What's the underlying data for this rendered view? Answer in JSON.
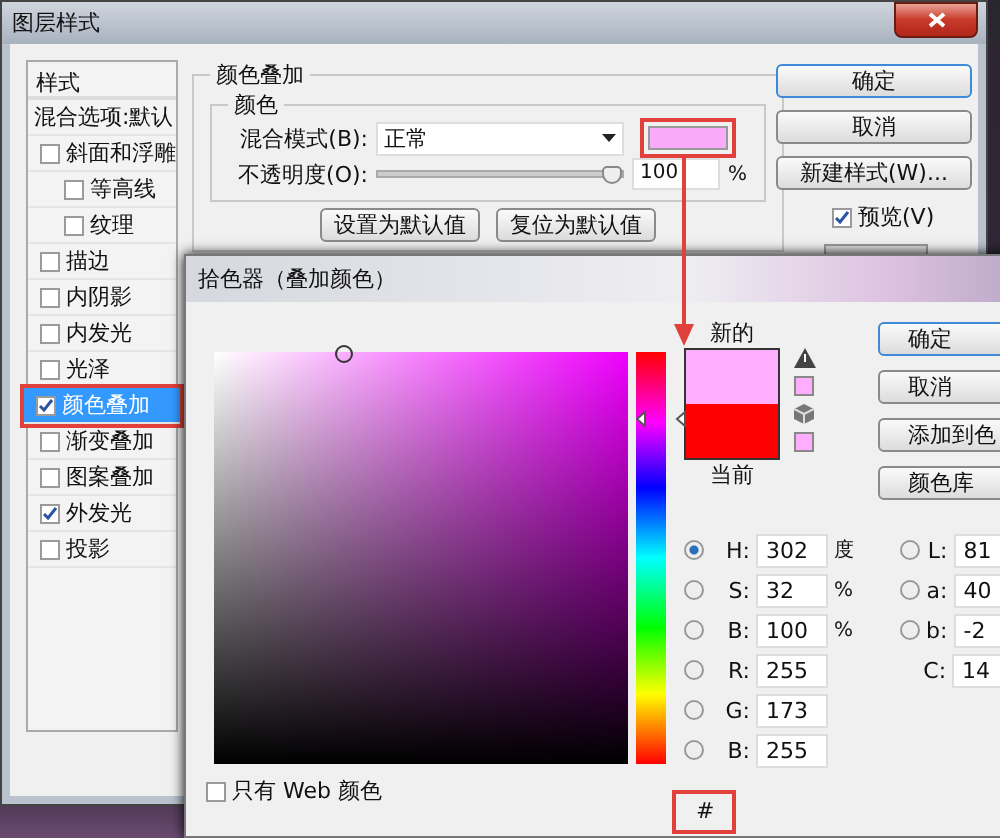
{
  "window": {
    "title": "图层样式"
  },
  "sidebar": {
    "header": "样式",
    "items": [
      {
        "label": "混合选项:默认",
        "kind": "header"
      },
      {
        "label": "斜面和浮雕",
        "kind": "option",
        "checked": false,
        "selected": false,
        "children": [
          {
            "label": "等高线",
            "kind": "option",
            "checked": false,
            "selected": false
          },
          {
            "label": "纹理",
            "kind": "option",
            "checked": false,
            "selected": false
          }
        ]
      },
      {
        "label": "描边",
        "kind": "option",
        "checked": false,
        "selected": false
      },
      {
        "label": "内阴影",
        "kind": "option",
        "checked": false,
        "selected": false
      },
      {
        "label": "内发光",
        "kind": "option",
        "checked": false,
        "selected": false
      },
      {
        "label": "光泽",
        "kind": "option",
        "checked": false,
        "selected": false
      },
      {
        "label": "颜色叠加",
        "kind": "option",
        "checked": true,
        "selected": true
      },
      {
        "label": "渐变叠加",
        "kind": "option",
        "checked": false,
        "selected": false
      },
      {
        "label": "图案叠加",
        "kind": "option",
        "checked": false,
        "selected": false
      },
      {
        "label": "外发光",
        "kind": "option",
        "checked": true,
        "selected": false
      },
      {
        "label": "投影",
        "kind": "option",
        "checked": false,
        "selected": false
      }
    ]
  },
  "color_overlay": {
    "title": "颜色叠加",
    "group_title": "颜色",
    "blend_mode_label": "混合模式(B):",
    "blend_mode": "正常",
    "color": "#f9aaf8",
    "opacity_label": "不透明度(O):",
    "opacity": {
      "level": 1,
      "value": "100",
      "unit": "%"
    },
    "buttons": [
      "设置为默认值",
      "复位为默认值"
    ]
  },
  "actions": {
    "buttons": [
      "确定",
      "取消",
      "新建样式(W)..."
    ],
    "preview": {
      "label": "预览(V)",
      "checked": true
    }
  },
  "color_picker": {
    "title": "拾色器（叠加颜色）",
    "new_label": "新的",
    "current_label": "当前",
    "new_swatch": {
      "color": "#ffadfe"
    },
    "current_swatch": {
      "color": "#ff0000"
    },
    "hue": {
      "level": 0.84
    },
    "buttons": [
      "确定",
      "取消",
      "添加到色",
      "颜色库"
    ],
    "fields": [
      {
        "label": "H:",
        "value": "302",
        "unit": "度",
        "selected": true
      },
      {
        "label": "S:",
        "value": "32",
        "unit": "%",
        "selected": false
      },
      {
        "label": "B:",
        "value": "100",
        "unit": "%",
        "selected": false
      },
      {
        "label": "R:",
        "value": "255",
        "selected": false
      },
      {
        "label": "G:",
        "value": "173",
        "selected": false
      },
      {
        "label": "B:",
        "value": "255",
        "selected": false
      }
    ],
    "fields_right": [
      {
        "label": "L:",
        "value": "81",
        "kind": "radio",
        "selected": false
      },
      {
        "label": "a:",
        "value": "40",
        "kind": "radio",
        "selected": false
      },
      {
        "label": "b:",
        "value": "-2",
        "kind": "radio",
        "selected": false
      },
      {
        "label": "C:",
        "value": "14",
        "kind": "plain"
      }
    ],
    "web_only": {
      "label": "只有 Web 颜色",
      "checked": false
    },
    "hex_label": "#"
  }
}
